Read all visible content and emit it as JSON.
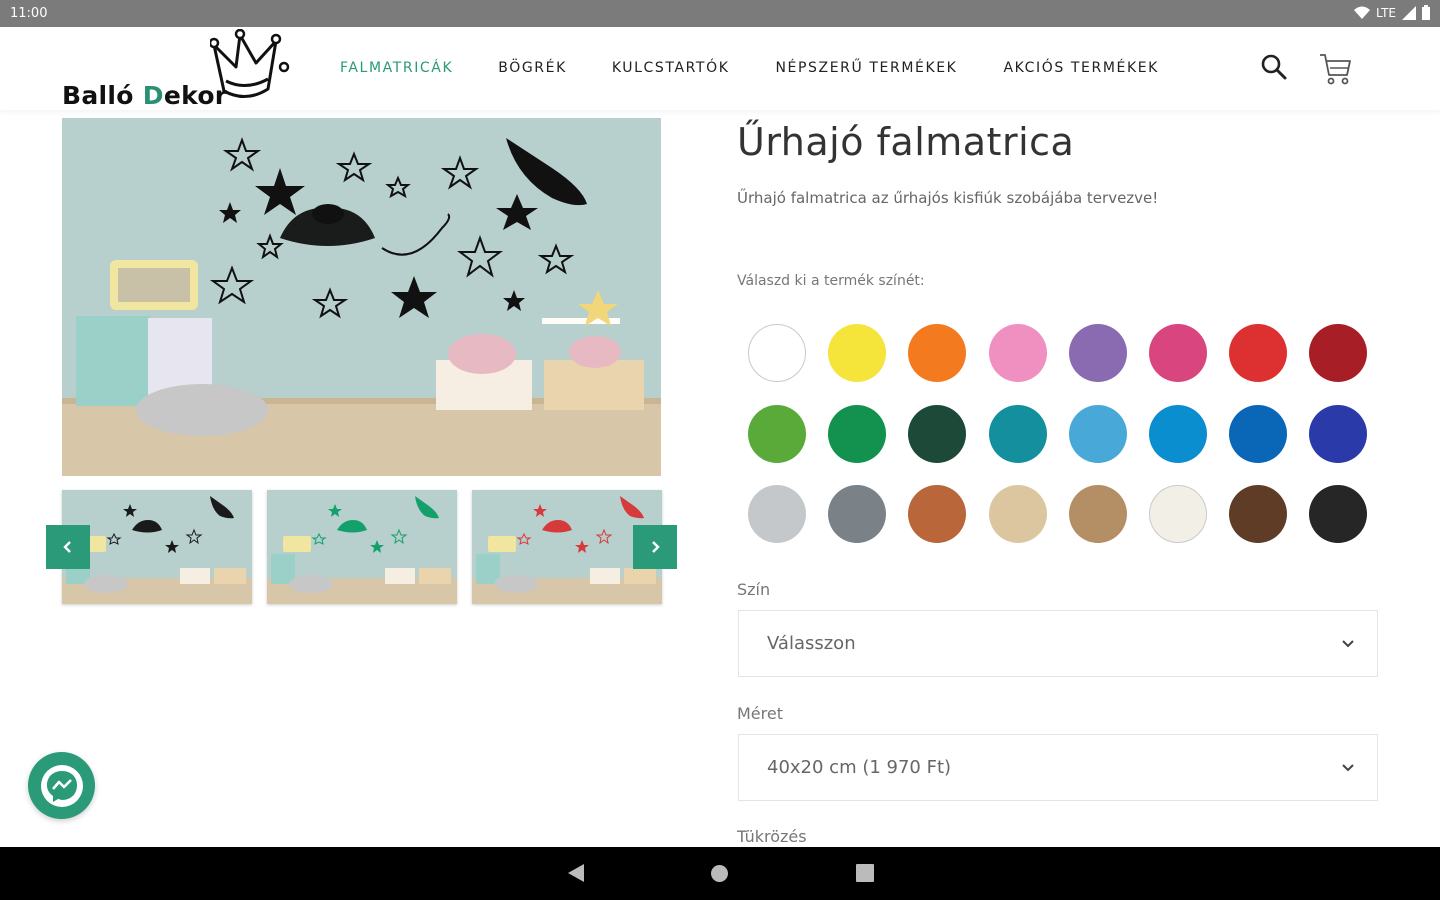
{
  "status_bar": {
    "time": "11:00",
    "network": "LTE"
  },
  "brand": {
    "part1": "Balló ",
    "part2": "D",
    "part3": "ekor",
    "accent_color": "#2b9a78"
  },
  "nav": {
    "items": [
      {
        "label": "FALMATRICÁK",
        "active": true
      },
      {
        "label": "BÖGRÉK",
        "active": false
      },
      {
        "label": "KULCSTARTÓK",
        "active": false
      },
      {
        "label": "NÉPSZERŰ TERMÉKEK",
        "active": false
      },
      {
        "label": "AKCIÓS TERMÉKEK",
        "active": false
      }
    ],
    "search_icon": "search-icon",
    "cart_icon": "cart-icon"
  },
  "product": {
    "title": "Űrhajó falmatrica",
    "description": "Űrhajó falmatrica az űrhajós kisfiúk szobájába tervezve!",
    "color_prompt": "Válaszd ki a termék színét:",
    "thumbnail_decal_colors": [
      "#1a1a1a",
      "#14a06a",
      "#d63a3a"
    ]
  },
  "swatches": [
    [
      "#ffffff",
      "#f5e43a",
      "#f47a20",
      "#f090c0",
      "#8a6ab0",
      "#d8457f",
      "#dd3030",
      "#a81e26"
    ],
    [
      "#5aaa3a",
      "#12924e",
      "#1d4a38",
      "#138f9e",
      "#48a8d8",
      "#0a8ed0",
      "#0a66b6",
      "#2a3aa8"
    ],
    [
      "#c5c8ca",
      "#7a8288",
      "#b8663a",
      "#dcc6a0",
      "#b48e64",
      "#f2f0e6",
      "#5e3c26",
      "#262626"
    ]
  ],
  "fields": {
    "color": {
      "label": "Szín",
      "value": "Válasszon"
    },
    "size": {
      "label": "Méret",
      "value": "40x20 cm (1 970 Ft)"
    },
    "mirror": {
      "label": "Tükrözés"
    }
  }
}
